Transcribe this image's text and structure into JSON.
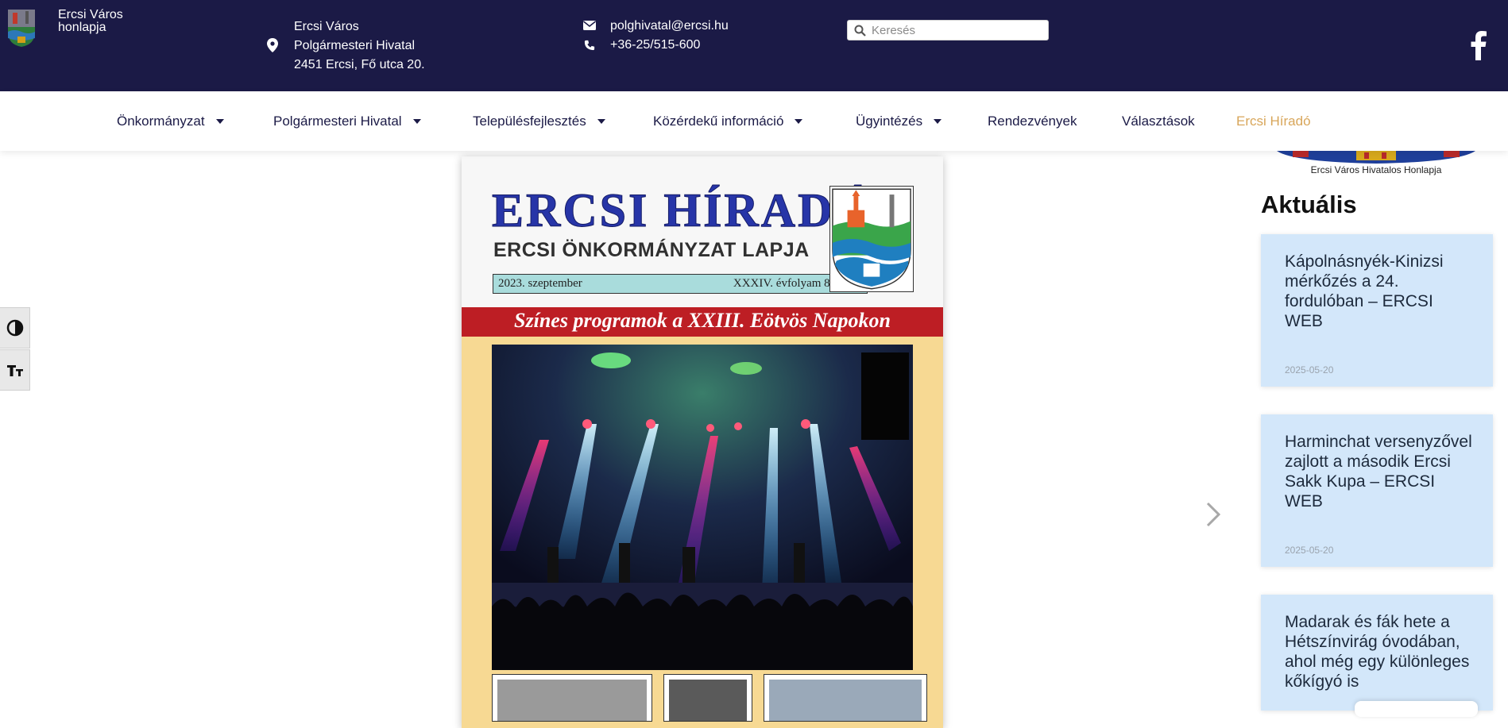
{
  "header": {
    "site_name": "Ercsi Város honlapja",
    "address": {
      "line1": "Ercsi Város",
      "line2": "Polgármesteri Hivatal",
      "line3": "2451 Ercsi, Fő utca 20."
    },
    "contact": {
      "email": "polghivatal@ercsi.hu",
      "phone": "+36-25/515-600"
    },
    "search": {
      "placeholder": "Keresés"
    },
    "social": {
      "icon": "facebook-icon"
    }
  },
  "nav": {
    "items": [
      {
        "label": "Önkormányzat",
        "dropdown": true
      },
      {
        "label": "Polgármesteri Hivatal",
        "dropdown": true
      },
      {
        "label": "Településfejlesztés",
        "dropdown": true
      },
      {
        "label": "Közérdekű információ",
        "dropdown": true
      },
      {
        "label": "Ügyintézés",
        "dropdown": true
      },
      {
        "label": "Rendezvények",
        "dropdown": false
      },
      {
        "label": "Választások",
        "dropdown": false
      },
      {
        "label": "Ercsi Híradó",
        "dropdown": false,
        "active": true
      }
    ],
    "active_color": "#d8a65a"
  },
  "accessibility": {
    "contrast_icon": "contrast-icon",
    "font_size_icon": "font-size-icon"
  },
  "cover": {
    "title": "ERCSI HÍRADÓ",
    "subtitle": "ERCSI ÖNKORMÁNYZAT LAPJA",
    "date": "2023. szeptember",
    "issue": "XXXIV. évfolyam 8. szám",
    "headline": "Színes programok a XXIII. Eötvös Napokon",
    "title_color": "#2735a8",
    "banner_color": "#bd1e24"
  },
  "sidebar": {
    "logo_caption": "Ercsi Város Hivatalos Honlapja",
    "heading": "Aktuális",
    "news": [
      {
        "title": "Kápolnásnyék-Kinizsi mérkőzés a 24. fordulóban – ERCSI WEB",
        "date": "2025-05-20"
      },
      {
        "title": "Harminchat versenyzővel zajlott a második Ercsi Sakk Kupa – ERCSI WEB",
        "date": "2025-05-20"
      },
      {
        "title": "Madarak és fák hete a Hétszínvirág óvodában, ahol még egy különleges kőkígyó is",
        "date": ""
      }
    ]
  },
  "colors": {
    "header_bg": "#1b1a46",
    "card_bg": "#d3e7fa"
  }
}
